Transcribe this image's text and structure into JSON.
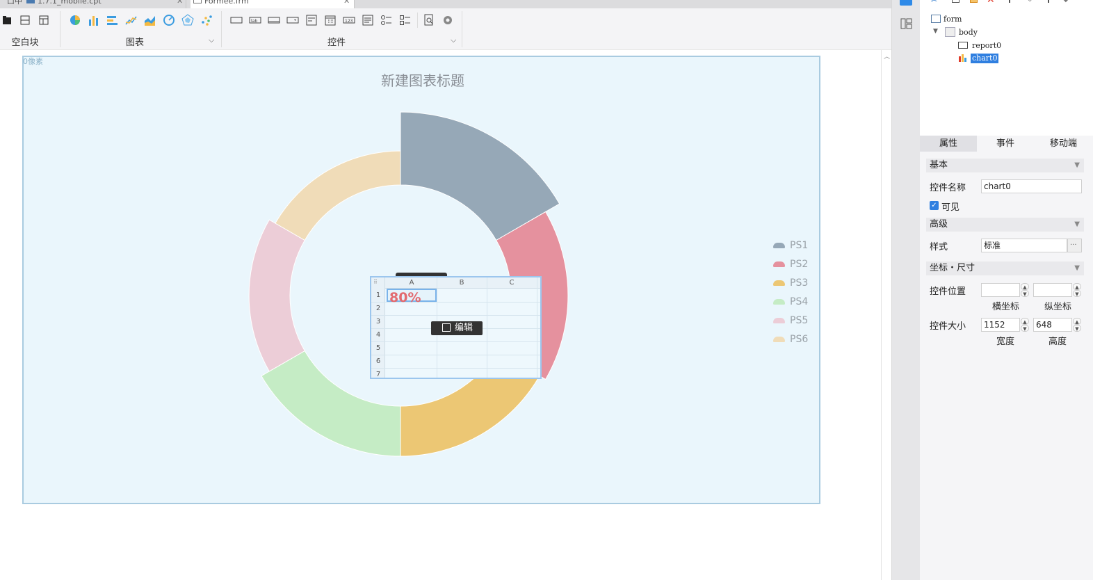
{
  "tabs": [
    {
      "label": "1.7.1_mobile.cpt"
    },
    {
      "label": "Formee.frm"
    }
  ],
  "tabs_left_label": "口中",
  "toolbar": {
    "groups": [
      {
        "label": "空白块"
      },
      {
        "label": "图表"
      },
      {
        "label": "控件"
      }
    ],
    "caret": "⌵"
  },
  "canvas": {
    "pixel_label": "0像素",
    "chart": {
      "title": "新建图表标题"
    },
    "report": {
      "columns": [
        "A",
        "B",
        "C"
      ],
      "rows": [
        "1",
        "2",
        "3",
        "4",
        "5",
        "6",
        "7"
      ],
      "cell_value": "80%",
      "edit_label": "编辑"
    }
  },
  "chart_data": {
    "type": "pie",
    "variant": "rose-ring",
    "title": "新建图表标题",
    "categories": [
      "PS1",
      "PS2",
      "PS3",
      "PS4",
      "PS5",
      "PS6"
    ],
    "values": [
      100,
      86,
      80,
      80,
      72,
      66
    ],
    "colors": [
      "#96a8b7",
      "#e5919e",
      "#ecc774",
      "#c5ecc5",
      "#eccdd7",
      "#f0dcb8"
    ],
    "legend": "right",
    "grid": false
  },
  "tree": {
    "nodes": [
      {
        "label": "form"
      },
      {
        "label": "body"
      },
      {
        "label": "report0"
      },
      {
        "label": "chart0"
      }
    ]
  },
  "props": {
    "tabs": [
      "属性",
      "事件",
      "移动端"
    ],
    "sections": {
      "basic": "基本",
      "advanced": "高级",
      "coord": "坐标・尺寸"
    },
    "name_label": "控件名称",
    "name_value": "chart0",
    "visible_label": "可见",
    "style_label": "样式",
    "style_value": "标准",
    "style_more": "···",
    "position_label": "控件位置",
    "pos_x_value": "",
    "pos_y_value": "",
    "x_label": "横坐标",
    "y_label": "纵坐标",
    "size_label": "控件大小",
    "width_value": "1152",
    "height_value": "648",
    "width_label": "宽度",
    "height_label": "高度"
  }
}
